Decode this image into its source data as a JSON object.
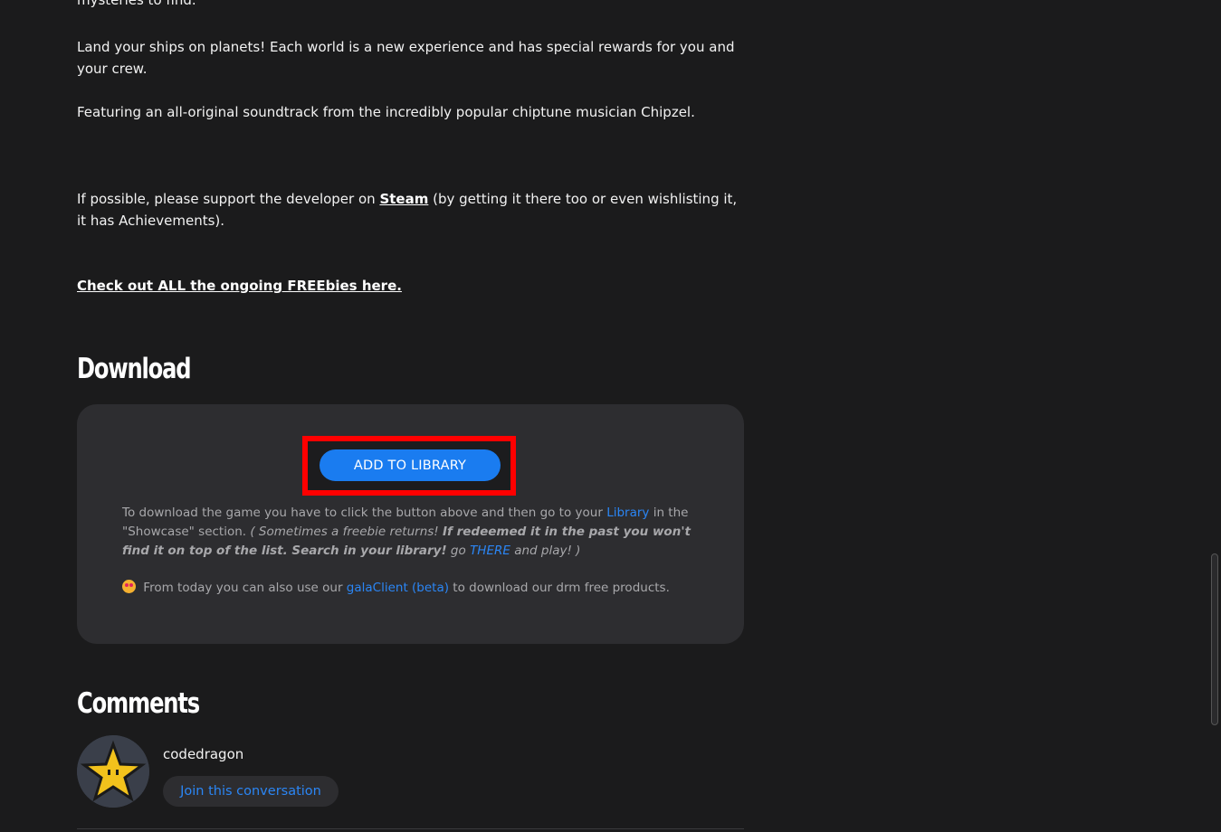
{
  "intro": {
    "fragment": "mysteries to find.",
    "p1": "Land your ships on planets! Each world is a new experience and has special rewards for you and your crew.",
    "p2": "Featuring an all-original soundtrack from the incredibly popular chiptune musician Chipzel.",
    "support_pre": "If possible, please support the developer on ",
    "support_link": "Steam",
    "support_post": " (by getting it there too or even wishlisting it, it has Achievements).",
    "freebies_link": "Check out ALL the ongoing FREEbies here."
  },
  "download": {
    "heading": "Download",
    "button_label": "ADD TO LIBRARY",
    "text_pre": "To download the game you have to click the button above and then go to your ",
    "library_link": "Library",
    "text_mid": " in the \"Showcase\" section. ",
    "italic_1": "( Sometimes a freebie returns! ",
    "bold_italic": "If redeemed it in the past you won't find it on top of the list. Search in your library!",
    "italic_2": " go ",
    "there_link": "THERE",
    "italic_3": " and play! )",
    "client_pre": " From today you can also use our ",
    "client_link": "galaClient (beta)",
    "client_post": " to download our drm free products."
  },
  "comments": {
    "heading": "Comments",
    "username": "codedragon",
    "join_label": "Join this conversation"
  },
  "colors": {
    "accent": "#1a7cf0",
    "link": "#2b86f5",
    "highlight": "#ff0000",
    "background": "#1b1b1c",
    "panel": "#2d2d30"
  }
}
